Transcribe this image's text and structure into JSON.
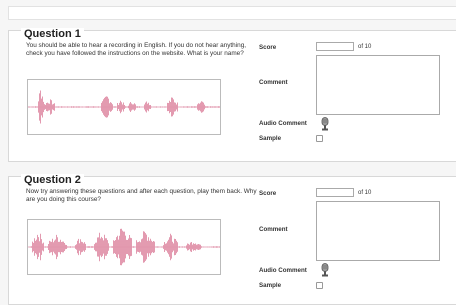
{
  "questions": [
    {
      "title": "Question 1",
      "prompt": "You should be able to hear a recording in English. If you do not hear anything, check you have followed the instructions on the website. What is your name?",
      "score_label": "Score",
      "score_value": "",
      "score_suffix": "of 10",
      "comment_label": "Comment",
      "comment_value": "",
      "audio_comment_label": "Audio Comment",
      "audio_icon": "microphone-icon",
      "sample_label": "Sample",
      "sample_checked": false
    },
    {
      "title": "Question 2",
      "prompt": "Now try answering these questions and after each question, play them back. Why are you doing this course?",
      "score_label": "Score",
      "score_value": "",
      "score_suffix": "of 10",
      "comment_label": "Comment",
      "comment_value": "",
      "audio_comment_label": "Audio Comment",
      "audio_icon": "microphone-icon",
      "sample_label": "Sample",
      "sample_checked": false
    }
  ],
  "colors": {
    "waveform": "#e090a8",
    "border": "#d8d8d8"
  }
}
